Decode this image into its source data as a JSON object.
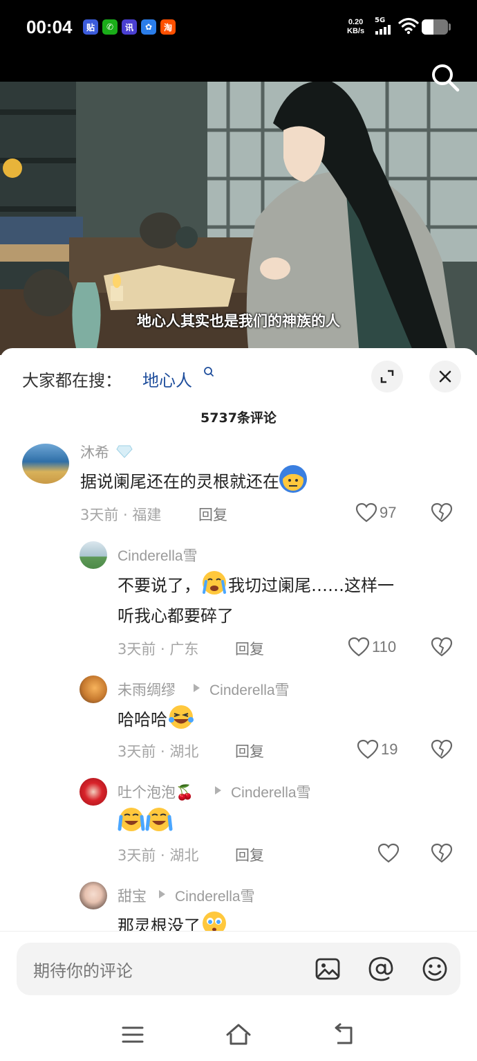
{
  "status_bar": {
    "time": "00:04",
    "net_speed": "0.20",
    "net_unit": "KB/s",
    "signal_type": "5G",
    "battery_level": 0.45,
    "app_icons": [
      {
        "name": "tieba-icon",
        "glyph": "贴",
        "color": "#3b5bdb"
      },
      {
        "name": "wechat-icon",
        "glyph": "✆",
        "color": "#1aad19"
      },
      {
        "name": "news-icon",
        "glyph": "讯",
        "color": "#4a3fd1"
      },
      {
        "name": "baidu-icon",
        "glyph": "✿",
        "color": "#2b7de9"
      },
      {
        "name": "taobao-icon",
        "glyph": "淘",
        "color": "#ff5000"
      }
    ]
  },
  "video": {
    "subtitle": "地心人其实也是我们的神族的人"
  },
  "sheet": {
    "hot_search_prefix": "大家都在搜：",
    "hot_search_term": "地心人",
    "comment_count": "5737条评论"
  },
  "comments": [
    {
      "user": "沐希",
      "text": "据说阑尾还在的灵根就还在",
      "emoji": "cold-face",
      "time": "3天前",
      "location": "福建",
      "reply_label": "回复",
      "likes": "97"
    },
    {
      "user": "Cinderella雪",
      "text_a": "不要说了，",
      "emoji": "cry-face",
      "text_b": "我切过阑尾……这样一",
      "text_c": "听我心都要碎了",
      "time": "3天前",
      "location": "广东",
      "reply_label": "回复",
      "likes": "110"
    },
    {
      "user": "未雨绸缪",
      "reply_to": "Cinderella雪",
      "text": "哈哈哈",
      "emoji": "laugh-tears-face",
      "time": "3天前",
      "location": "湖北",
      "reply_label": "回复",
      "likes": "19"
    },
    {
      "user": "吐个泡泡🍒",
      "reply_to": "Cinderella雪",
      "text": "",
      "emoji": "loud-crying-face",
      "time": "3天前",
      "location": "湖北",
      "reply_label": "回复",
      "likes": ""
    },
    {
      "user": "甜宝",
      "reply_to": "Cinderella雪",
      "text": "那灵根没了",
      "emoji": "teary-face"
    }
  ],
  "input_bar": {
    "placeholder": "期待你的评论"
  },
  "colors": {
    "hot_term": "#1f4e9c",
    "emoji_yellow": "#ffc83d"
  }
}
